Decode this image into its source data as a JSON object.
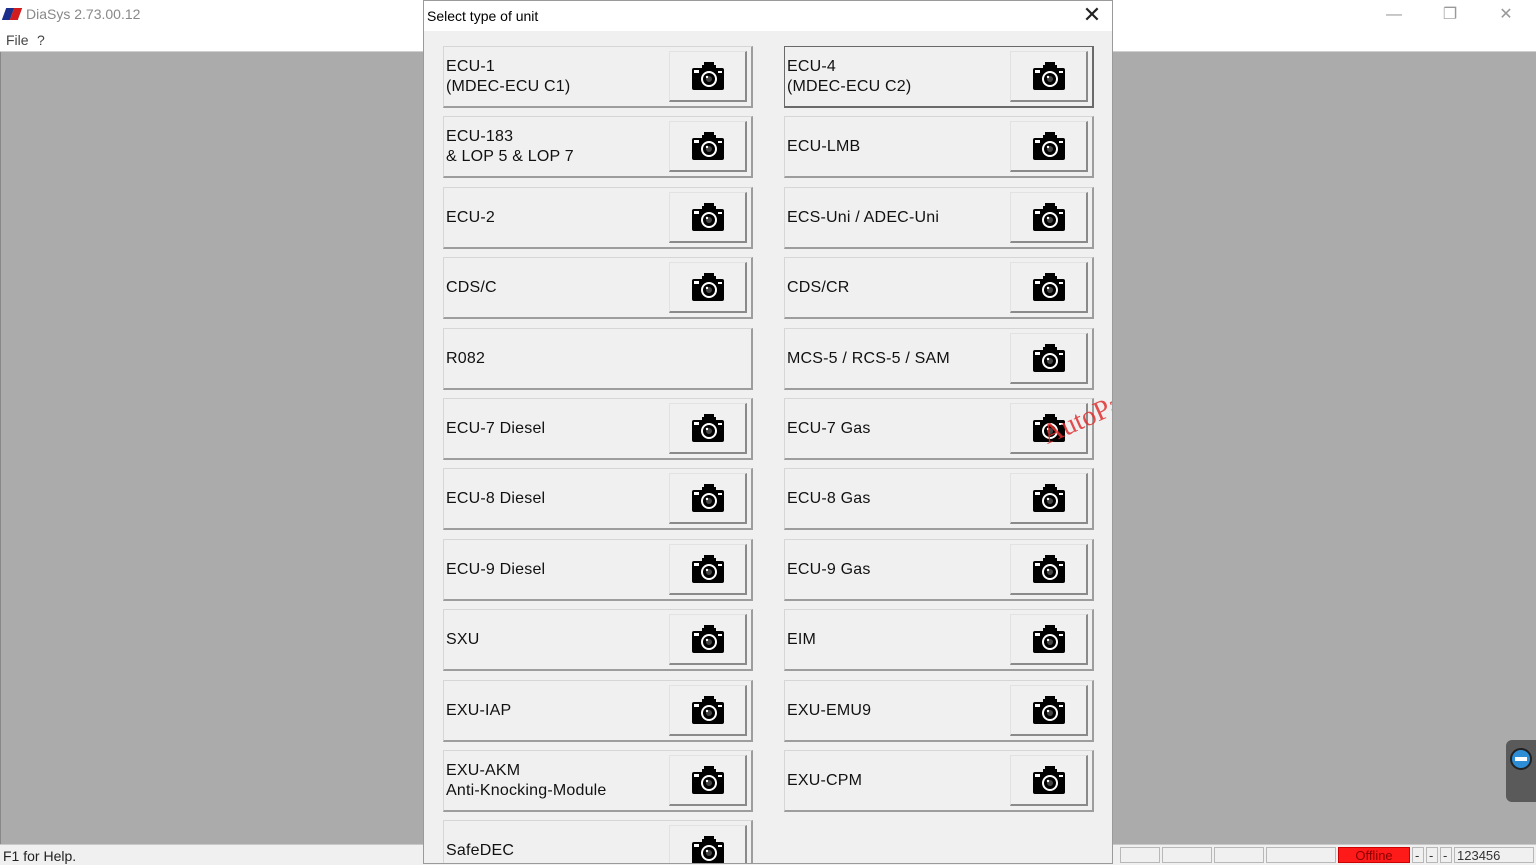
{
  "app": {
    "title": "DiaSys 2.73.00.12",
    "minimize_glyph": "—",
    "restore_glyph": "❐",
    "close_glyph": "✕"
  },
  "menu": {
    "file": "File",
    "help": "?"
  },
  "status": {
    "help_text": "F1 for Help.",
    "offline": "Offline",
    "cell1": "-",
    "cell2": "-",
    "cell3": "-",
    "code": "123456"
  },
  "dialog": {
    "title": "Select type of unit",
    "close_glyph": "✕"
  },
  "units": [
    {
      "label": "ECU-1\n(MDEC-ECU C1)"
    },
    {
      "label": "ECU-4\n(MDEC-ECU C2)"
    },
    {
      "label": "ECU-183\n& LOP 5 & LOP 7"
    },
    {
      "label": "ECU-LMB"
    },
    {
      "label": "ECU-2"
    },
    {
      "label": "ECS-Uni / ADEC-Uni"
    },
    {
      "label": "CDS/C"
    },
    {
      "label": "CDS/CR"
    },
    {
      "label": "R082"
    },
    {
      "label": "MCS-5 / RCS-5 / SAM"
    },
    {
      "label": "ECU-7 Diesel"
    },
    {
      "label": "ECU-7 Gas"
    },
    {
      "label": "ECU-8 Diesel"
    },
    {
      "label": "ECU-8 Gas"
    },
    {
      "label": "ECU-9 Diesel"
    },
    {
      "label": "ECU-9 Gas"
    },
    {
      "label": "SXU"
    },
    {
      "label": "EIM"
    },
    {
      "label": "EXU-IAP"
    },
    {
      "label": "EXU-EMU9"
    },
    {
      "label": "EXU-AKM\nAnti-Knocking-Module"
    },
    {
      "label": "EXU-CPM"
    },
    {
      "label": "SafeDEC"
    }
  ],
  "watermark": "AutoPartsCatalogue.NET"
}
